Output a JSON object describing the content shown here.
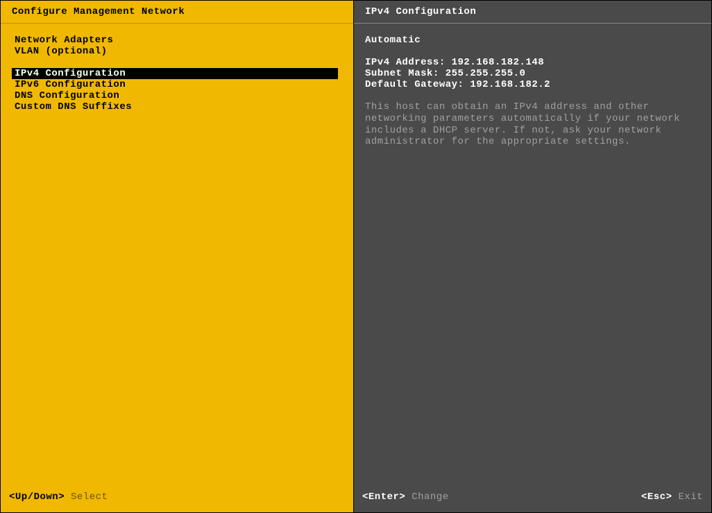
{
  "left": {
    "title": "Configure Management Network",
    "menu_group_1": {
      "item_0": "Network Adapters",
      "item_1": "VLAN (optional)"
    },
    "menu_group_2": {
      "item_0": "IPv4 Configuration",
      "item_1": "IPv6 Configuration",
      "item_2": "DNS Configuration",
      "item_3": "Custom DNS Suffixes"
    }
  },
  "right": {
    "title": "IPv4 Configuration",
    "mode": "Automatic",
    "ipv4_label": "IPv4 Address:",
    "ipv4_value": "192.168.182.148",
    "mask_label": "Subnet Mask:",
    "mask_value": "255.255.255.0",
    "gw_label": "Default Gateway:",
    "gw_value": "192.168.182.2",
    "help": "This host can obtain an IPv4 address and other networking parameters automatically if your network includes a DHCP server. If not, ask your network administrator for the appropriate settings."
  },
  "footer": {
    "left_key": "<Up/Down>",
    "left_action": "Select",
    "right_key_1": "<Enter>",
    "right_action_1": "Change",
    "right_key_2": "<Esc>",
    "right_action_2": "Exit"
  }
}
